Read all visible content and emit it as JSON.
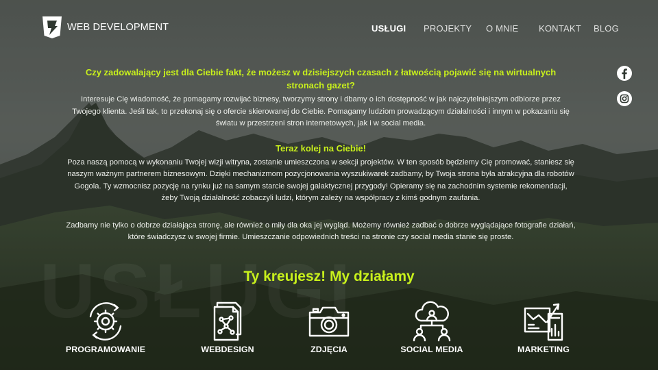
{
  "header": {
    "logo_icon": "bolt-shield-icon",
    "logo_text": "WEB DEVELOPMENT",
    "nav": [
      "USŁUGI",
      "PROJEKTY",
      "O MNIE",
      "KONTAKT",
      "BLOG"
    ],
    "active_nav": "USŁUGI"
  },
  "social": [
    "facebook-icon",
    "instagram-icon"
  ],
  "intro": {
    "headline": "Czy zadowalający jest dla Ciebie fakt, że możesz w dzisiejszych czasach z łatwością pojawić się na wirtualnych stronach gazet?",
    "paragraph": "Interesuje Cię wiadomość, że pomagamy rozwijać biznesy, tworzymy strony i dbamy o ich dostępność w jak najczytelniejszym odbiorze przez Twojego klienta. Jeśli tak, to przekonaj się o ofercie skierowanej do Ciebie. Pomagamy ludziom prowadzącym działalności i innym w pokazaniu się światu w przestrzeni stron internetowych, jak i w social media.",
    "subheadline": "Teraz kolej na Ciebie!",
    "paragraph2": "Poza naszą pomocą w wykonaniu Twojej wizji witryna, zostanie umieszczona w sekcji projektów. W ten sposób będziemy Cię promować, staniesz się naszym ważnym partnerem biznesowym. Dzięki mechanizmom pozycjonowania wyszukiwarek zadbamy, by Twoja strona była atrakcyjna dla robotów Gogola. Ty wzmocnisz pozycję na rynku już na samym starcie swojej galaktycznej przygody! Opieramy się na zachodnim systemie rekomendacji, żeby Twoją działalność zobaczyli ludzi, którym zależy na współpracy z kimś godnym zaufania.",
    "paragraph3": "Zadbamy nie tylko o dobrze działająca stronę, ale również o miły dla oka jej wygląd. Możemy również zadbać o dobrze wyglądające fotografie działań, które świadczysz w swojej firmie. Umieszczanie odpowiednich treści na stronie czy social media stanie się proste."
  },
  "watermark": "USŁUGI",
  "services_section": {
    "title": "Ty kreujesz! My działamy",
    "items": [
      {
        "label": "PROGRAMOWANIE",
        "icon": "gear-cycle-icon"
      },
      {
        "label": "WEBDESIGN",
        "icon": "webdesign-documents-icon"
      },
      {
        "label": "ZDJĘCIA",
        "icon": "camera-icon"
      },
      {
        "label": "SOCIAL MEDIA",
        "icon": "cloud-users-icon"
      },
      {
        "label": "MARKETING",
        "icon": "analytics-monitor-icon"
      }
    ]
  },
  "colors": {
    "accent": "#c8f01c",
    "text": "#ffffff"
  }
}
